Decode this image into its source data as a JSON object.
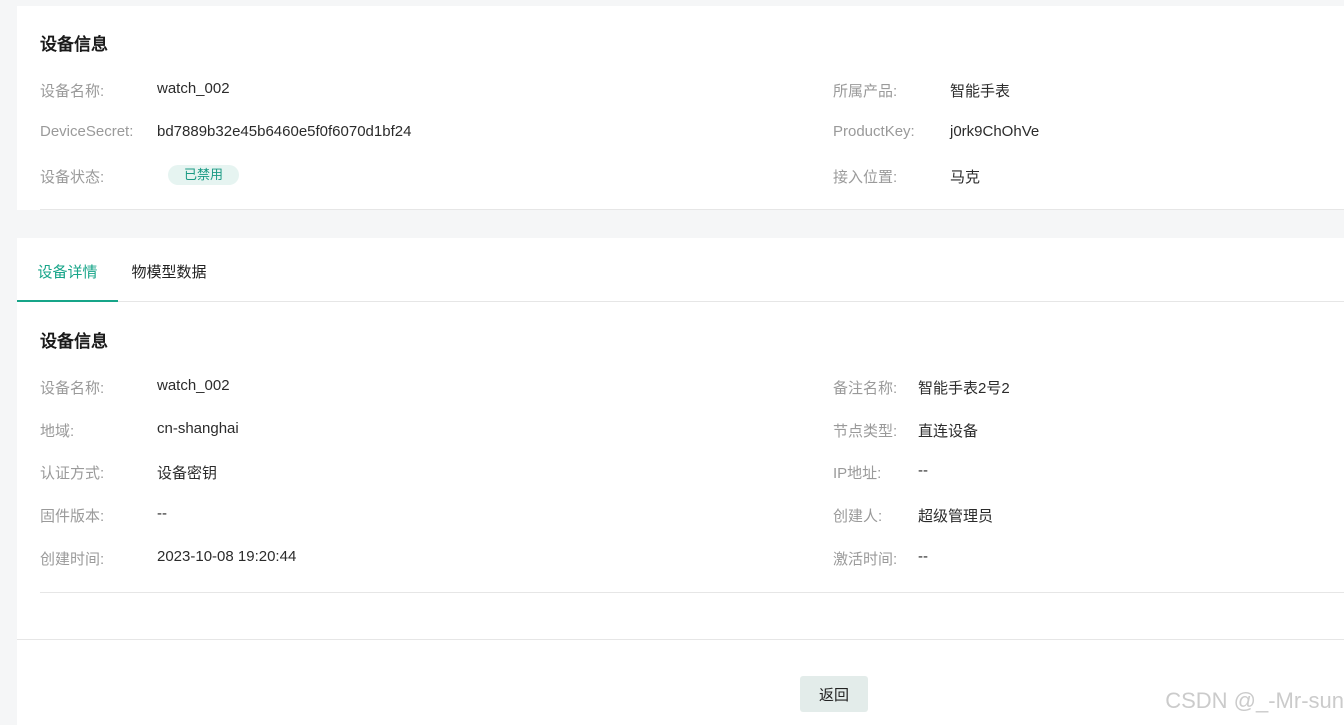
{
  "device_info_card": {
    "title": "设备信息",
    "name_label": "设备名称:",
    "name_value": "watch_002",
    "product_label": "所属产品:",
    "product_value": "智能手表",
    "secret_label": "DeviceSecret:",
    "secret_value": "bd7889b32e45b6460e5f0f6070d1bf24",
    "productkey_label": "ProductKey:",
    "productkey_value": "j0rk9ChOhVe",
    "status_label": "设备状态:",
    "status_badge": "已禁用",
    "location_label": "接入位置:",
    "location_value": "马克"
  },
  "tabs": [
    {
      "label": "设备详情",
      "active": true
    },
    {
      "label": "物模型数据",
      "active": false
    }
  ],
  "details": {
    "title": "设备信息",
    "left": [
      {
        "label": "设备名称:",
        "value": "watch_002"
      },
      {
        "label": "地域:",
        "value": "cn-shanghai"
      },
      {
        "label": "认证方式:",
        "value": "设备密钥"
      },
      {
        "label": "固件版本:",
        "value": "--"
      },
      {
        "label": "创建时间:",
        "value": "2023-10-08 19:20:44"
      }
    ],
    "right": [
      {
        "label": "备注名称:",
        "value": "智能手表2号2"
      },
      {
        "label": "节点类型:",
        "value": "直连设备"
      },
      {
        "label": "IP地址:",
        "value": "--"
      },
      {
        "label": "创建人:",
        "value": "超级管理员"
      },
      {
        "label": "激活时间:",
        "value": "--"
      }
    ]
  },
  "footer": {
    "back_label": "返回"
  },
  "watermark": "CSDN @_-Mr-sun",
  "colors": {
    "accent": "#17a589",
    "badge_bg": "#e6f4f1",
    "badge_text": "#1a9a84"
  }
}
